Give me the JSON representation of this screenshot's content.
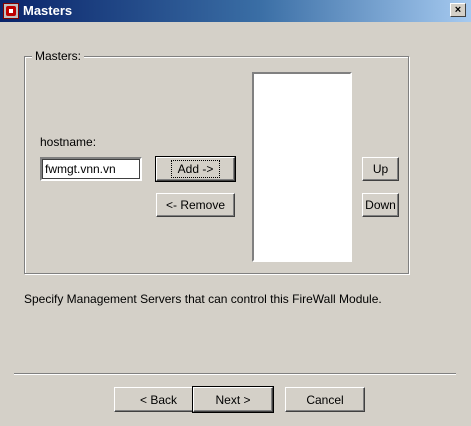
{
  "window": {
    "title": "Masters",
    "close_glyph": "×"
  },
  "icons": {
    "app": "firewall-app-icon",
    "close": "close-icon"
  },
  "group": {
    "label": "Masters:"
  },
  "form": {
    "hostname_label": "hostname:",
    "hostname_value": "fwmgt.vnn.vn"
  },
  "buttons": {
    "add": "Add ->",
    "remove": "<- Remove",
    "up": "Up",
    "down": "Down"
  },
  "masters_list": {
    "items": []
  },
  "hint": "Specify Management Servers that can control this FireWall Module.",
  "footer": {
    "back": "< Back",
    "next": "Next >",
    "cancel": "Cancel"
  },
  "colors": {
    "face": "#d4d0c8",
    "title_start": "#0a246a",
    "title_end": "#a6caf0"
  }
}
